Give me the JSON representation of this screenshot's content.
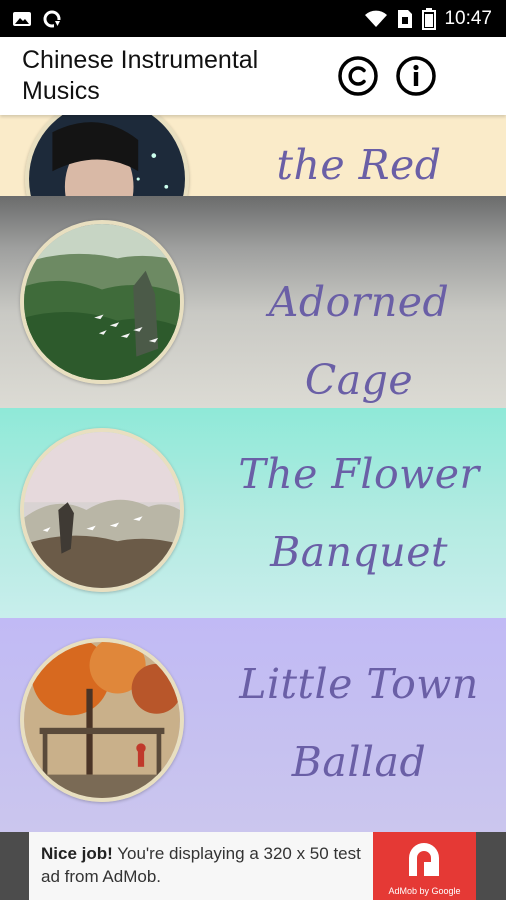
{
  "status_bar": {
    "time": "10:47",
    "icons_left": [
      "gallery-icon",
      "sync-icon"
    ],
    "icons_right": [
      "wifi-icon",
      "sim-icon",
      "battery-icon"
    ]
  },
  "app_bar": {
    "title": "Chinese Instrumental Musics",
    "icons": [
      "copyright-icon",
      "info-icon"
    ]
  },
  "tracks": [
    {
      "title": "the Red Lotus",
      "bg": "#faebc9"
    },
    {
      "title": "Adorned Cage",
      "bg": "#c9c9c4"
    },
    {
      "title": "The Flower Banquet",
      "bg": "#b4ebe2"
    },
    {
      "title": "Little Town Ballad",
      "bg": "#c6c1f0"
    }
  ],
  "ad": {
    "headline": "Nice job!",
    "body": "You're displaying a 320 x 50 test ad from AdMob.",
    "logo_caption": "AdMob by Google",
    "accent": "#e53935"
  },
  "colors": {
    "title_text": "#6a5fa6",
    "status_bar": "#000000"
  }
}
